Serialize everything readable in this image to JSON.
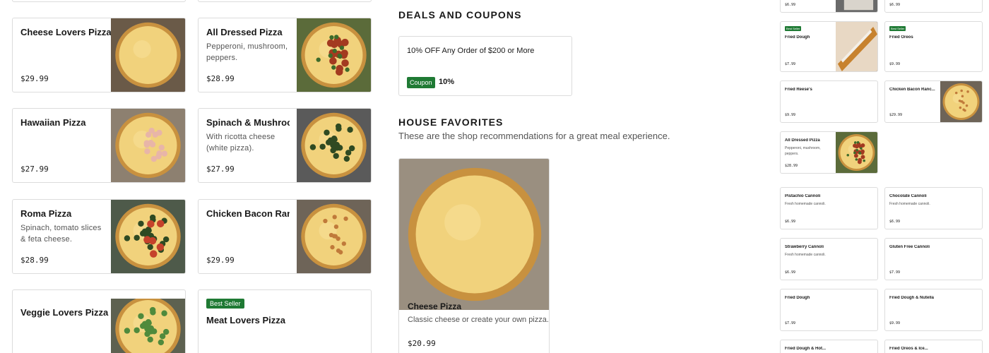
{
  "menu": {
    "items": [
      {
        "name": "Cheese Lovers Pizza",
        "desc": "",
        "price": "$29.99",
        "img": "cheese"
      },
      {
        "name": "All Dressed Pizza",
        "desc": "Pepperoni, mushroom, peppers.",
        "price": "$28.99",
        "img": "dressed"
      },
      {
        "name": "Hawaiian Pizza",
        "desc": "",
        "price": "$27.99",
        "img": "hawaiian"
      },
      {
        "name": "Spinach & Mushroom",
        "desc": "With ricotta cheese (white pizza).",
        "price": "$27.99",
        "img": "spinach"
      },
      {
        "name": "Roma Pizza",
        "desc": "Spinach, tomato slices & feta cheese.",
        "price": "$28.99",
        "img": "roma"
      },
      {
        "name": "Chicken Bacon Ranch",
        "desc": "",
        "price": "$29.99",
        "img": "chicken"
      },
      {
        "name": "Veggie Lovers Pizza",
        "desc": "",
        "price": "",
        "img": "veggie"
      },
      {
        "name": "Meat Lovers Pizza",
        "desc": "",
        "price": "",
        "badge": "Best Seller"
      }
    ]
  },
  "deals": {
    "title": "DEALS AND COUPONS",
    "coupon_text": "10% OFF Any Order of $200 or More",
    "coupon_badge": "Coupon",
    "coupon_value": "10%"
  },
  "favorites": {
    "title": "HOUSE FAVORITES",
    "subtitle": "These are the shop recommendations for a great meal experience.",
    "feature": {
      "name": "Cheese Pizza",
      "desc": "Classic cheese or create your own pizza.",
      "price": "$20.99"
    }
  },
  "sidebar": {
    "cards": [
      {
        "name": "",
        "desc": "",
        "price": "$6.99",
        "thumb": true,
        "badge": ""
      },
      {
        "name": "",
        "desc": "",
        "price": "$6.99",
        "thumb": false,
        "badge": ""
      },
      {
        "name": "Fried Dough",
        "desc": "",
        "price": "$7.99",
        "thumb": true,
        "badge": "Best Seller"
      },
      {
        "name": "Fried Oreos",
        "desc": "",
        "price": "$9.99",
        "thumb": false,
        "badge": "Best Seller"
      },
      {
        "name": "Fried Reese's",
        "desc": "",
        "price": "$9.99",
        "thumb": false,
        "badge": ""
      },
      {
        "name": "Chicken Bacon Ranc...",
        "desc": "",
        "price": "$29.99",
        "thumb": true,
        "badge": ""
      },
      {
        "name": "All Dressed Pizza",
        "desc": "Pepperoni, mushroom, peppers.",
        "price": "$28.99",
        "thumb": true,
        "badge": ""
      },
      {
        "name": "Pistachio Cannoli",
        "desc": "Fresh homemade cannoli.",
        "price": "$6.99",
        "thumb": false,
        "badge": ""
      },
      {
        "name": "Chocolate Cannoli",
        "desc": "Fresh homemade cannoli.",
        "price": "$6.99",
        "thumb": false,
        "badge": ""
      },
      {
        "name": "Strawberry Cannoli",
        "desc": "Fresh homemade cannoli.",
        "price": "$6.99",
        "thumb": false,
        "badge": ""
      },
      {
        "name": "Gluten Free Cannoli",
        "desc": "",
        "price": "$7.99",
        "thumb": false,
        "badge": ""
      },
      {
        "name": "Fried Dough",
        "desc": "",
        "price": "$7.99",
        "thumb": false,
        "badge": ""
      },
      {
        "name": "Fried Dough & Nutella",
        "desc": "",
        "price": "$9.99",
        "thumb": false,
        "badge": ""
      },
      {
        "name": "Fried Dough & Hot...",
        "desc": "",
        "price": "",
        "thumb": false,
        "badge": ""
      },
      {
        "name": "Fried Oreos & Ice...",
        "desc": "",
        "price": "",
        "thumb": false,
        "badge": ""
      }
    ]
  }
}
